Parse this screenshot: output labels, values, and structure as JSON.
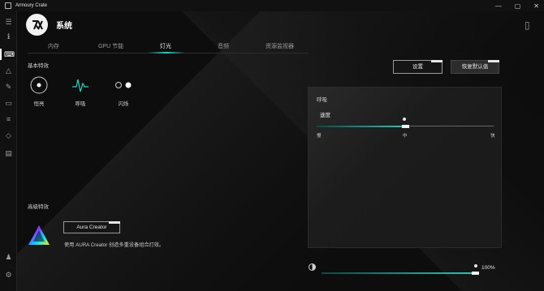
{
  "titlebar": {
    "title": "Armoury Crate",
    "minimize": "—",
    "maximize": "▢",
    "close": "✕"
  },
  "header": {
    "title": "系统"
  },
  "tabs": [
    {
      "label": "内存"
    },
    {
      "label": "GPU 节能"
    },
    {
      "label": "灯光",
      "active": true
    },
    {
      "label": "音频"
    },
    {
      "label": "资源监视器"
    }
  ],
  "basic": {
    "label": "基本特效",
    "effects": [
      {
        "label": "恒亮",
        "icon": "static-icon"
      },
      {
        "label": "呼吸",
        "icon": "breathing-icon",
        "selected": true
      },
      {
        "label": "闪烁",
        "icon": "strobing-icon"
      }
    ]
  },
  "buttons": {
    "settings": "设置",
    "reset": "恢复默认值"
  },
  "panel": {
    "title": "呼吸",
    "speed_label": "速度",
    "speed_value": 0.5,
    "ticks": {
      "slow": "慢",
      "medium": "中",
      "fast": "快"
    }
  },
  "advanced": {
    "label": "高级特效",
    "aura_button": "Aura Creator",
    "description": "使用 AURA Creator 创造多重设备组合灯效。"
  },
  "brightness": {
    "value_label": "100%",
    "value": 1.0
  },
  "colors": {
    "accent": "#1cd6c2",
    "background": "#0d0d0d",
    "panel": "#1b1b1b"
  }
}
